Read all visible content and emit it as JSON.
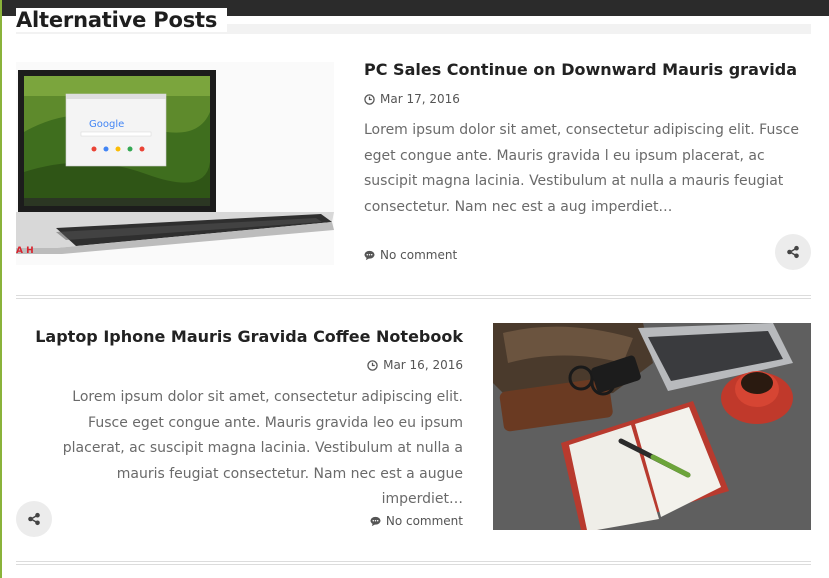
{
  "section": {
    "title": "Alternative Posts"
  },
  "posts": [
    {
      "title": "PC Sales Continue on Downward Mauris gravida",
      "date": "Mar 17, 2016",
      "excerpt": "Lorem ipsum dolor sit amet, consectetur adipiscing elit. Fusce eget congue ante. Mauris gravida l eu ipsum placerat, ac suscipit magna lacinia. Vestibulum at nulla a mauris feugiat consectetur. Nam nec est a aug  imperdiet…",
      "comments": "No comment",
      "image_brand": "Google",
      "image_badge": "A H"
    },
    {
      "title": "Laptop Iphone Mauris Gravida Coffee Notebook",
      "date": "Mar 16, 2016",
      "excerpt": "Lorem ipsum dolor sit amet, consectetur adipiscing elit. Fusce eget congue ante. Mauris gravida leo eu ipsum placerat, ac suscipit magna lacinia. Vestibulum at nulla a mauris feugiat consectetur. Nam nec est a augue imperdiet…",
      "comments": "No comment"
    }
  ],
  "icons": {
    "date": "clock-icon",
    "comments": "comment-icon",
    "share": "share-icon"
  },
  "colors": {
    "topbar": "#2b2b2b",
    "accent": "#8ab33a",
    "share_bg": "#ececec",
    "badge": "#d9232e"
  }
}
